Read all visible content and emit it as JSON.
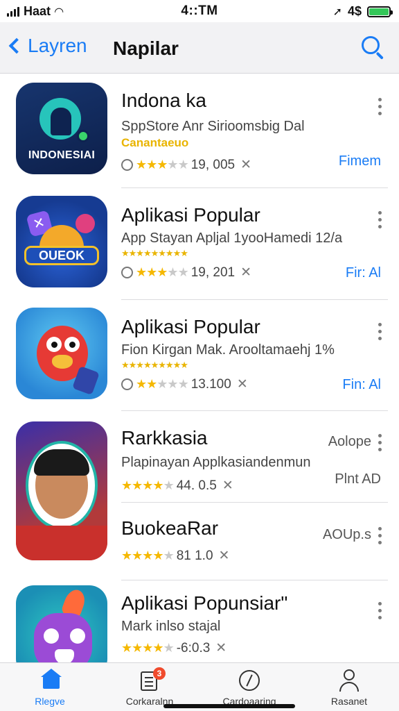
{
  "status_bar": {
    "carrier": "Haat",
    "time": "4::TM",
    "battery_text": "4$"
  },
  "nav": {
    "back_label": "Layren",
    "title": "Napilar"
  },
  "apps": [
    {
      "name": "Indona ka",
      "subtitle": "SppStore Anr Sirioomsbig Dal",
      "tag": "Canantaeuo",
      "rating_text": "19, 005",
      "stars": 3,
      "action": "Fimem",
      "icon_text": "INDONESIAI",
      "icon": "indonesia-app-icon"
    },
    {
      "name": "Aplikasi Popular",
      "subtitle": "App Stayan Apljal 1yooHamedi 12/a",
      "tag": "★★★★★★★★★",
      "rating_text": "19, 201",
      "stars": 3,
      "action": "Fir: Al",
      "icon_text": "OUEOK",
      "icon": "game-app-icon"
    },
    {
      "name": "Aplikasi Popular",
      "subtitle": "Fion Kirgan Mak. Arooltamaehj 1%",
      "tag": "★★★★★★★★★",
      "rating_text": "13.100",
      "stars": 2,
      "action": "Fin: Al",
      "icon": "bird-app-icon"
    },
    {
      "name": "Rarkkasia",
      "subtitle": "Plapinayan Applkasiandenmun",
      "rating_text": "44. 0.5",
      "stars": 4,
      "action": "Plnt AD",
      "price": "Aolope",
      "icon": "portrait-app-icon"
    },
    {
      "name": "BuokeaRar",
      "rating_text": "81 1.0",
      "stars": 4,
      "price": "AOUp.s"
    },
    {
      "name": "Aplikasi Popunsiar\"",
      "subtitle": "Mark inlso stajal",
      "rating_text": "-6:0.3",
      "stars": 4,
      "icon": "pet-app-icon"
    }
  ],
  "tabs": [
    {
      "label": "Rlegve",
      "icon": "home-icon",
      "active": true
    },
    {
      "label": "Corkaralnn",
      "icon": "document-icon",
      "badge": "3"
    },
    {
      "label": "Cardoaaring",
      "icon": "compass-icon"
    },
    {
      "label": "Rasanet",
      "icon": "person-icon"
    }
  ],
  "colors": {
    "accent": "#1a7cf5",
    "star": "#f5b800",
    "battery": "#34c759",
    "badge": "#f04b2d"
  }
}
